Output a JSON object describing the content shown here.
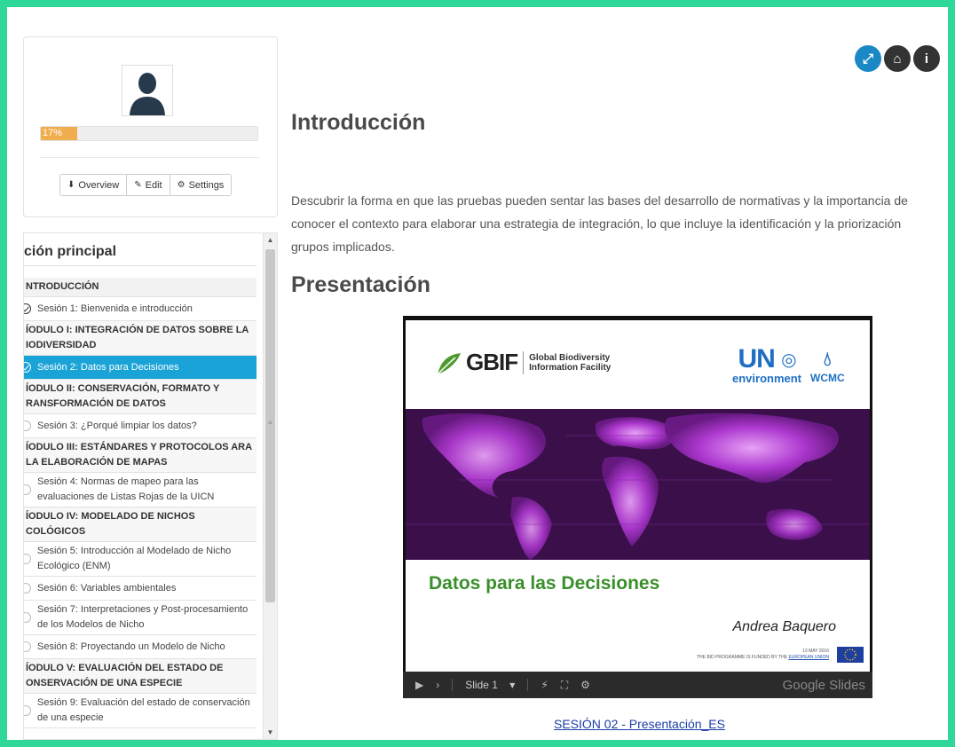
{
  "colors": {
    "frame": "#2fd899",
    "progress": "#f0ad4e",
    "active_item": "#1aa3d6",
    "icon_expand": "#1a88c4",
    "icon_home": "#333333",
    "icon_info": "#333333",
    "slide_title": "#3a8f2b",
    "un_blue": "#1e6fc4",
    "link": "#1a3ea8"
  },
  "profile": {
    "avatar_icon": "user-silhouette-icon",
    "progress_label": "17%",
    "progress_value": 0.17,
    "buttons": [
      {
        "icon": "download-icon",
        "label": "Overview"
      },
      {
        "icon": "pencil-icon",
        "label": "Edit"
      },
      {
        "icon": "gear-icon",
        "label": "Settings"
      }
    ]
  },
  "nav": {
    "title": "ción principal",
    "items": [
      {
        "type": "module",
        "text": "NTRODUCCIÓN"
      },
      {
        "type": "session",
        "text": "Sesión 1: Bienvenida e introducción",
        "done": true,
        "active": false
      },
      {
        "type": "module",
        "text": "ÍODULO I: INTEGRACIÓN DE DATOS SOBRE LA IODIVERSIDAD"
      },
      {
        "type": "session",
        "text": "Sesión 2: Datos para Decisiones",
        "done": true,
        "active": true
      },
      {
        "type": "module",
        "text": "ÍODULO II: CONSERVACIÓN, FORMATO Y RANSFORMACIÓN DE DATOS"
      },
      {
        "type": "session",
        "text": "Sesión 3: ¿Porqué limpiar los datos?",
        "done": false,
        "active": false
      },
      {
        "type": "module",
        "text": "ÍODULO III: ESTÁNDARES Y PROTOCOLOS ARA LA ELABORACIÓN DE MAPAS"
      },
      {
        "type": "session",
        "text": "Sesión 4: Normas de mapeo para las evaluaciones de Listas Rojas de la UICN",
        "done": false,
        "active": false
      },
      {
        "type": "module",
        "text": "ÍODULO IV: MODELADO DE NICHOS COLÓGICOS"
      },
      {
        "type": "session",
        "text": "Sesión 5: Introducción al Modelado de Nicho Ecológico (ENM)",
        "done": false,
        "active": false
      },
      {
        "type": "session",
        "text": "Sesión 6: Variables ambientales",
        "done": false,
        "active": false
      },
      {
        "type": "session",
        "text": "Sesión 7: Interpretaciones y Post-procesamiento de los Modelos de Nicho",
        "done": false,
        "active": false
      },
      {
        "type": "session",
        "text": "Sesión 8: Proyectando un Modelo de Nicho",
        "done": false,
        "active": false
      },
      {
        "type": "module",
        "text": "ÍODULO V: EVALUACIÓN DEL ESTADO DE ONSERVACIÓN DE UNA ESPECIE"
      },
      {
        "type": "session",
        "text": "Sesión 9: Evaluación del estado de conservación de una especie",
        "done": false,
        "active": false
      }
    ]
  },
  "top_icons": [
    {
      "name": "expand-icon",
      "glyph": "⤢"
    },
    {
      "name": "home-icon",
      "glyph": "⌂"
    },
    {
      "name": "info-icon",
      "glyph": "i"
    }
  ],
  "main": {
    "heading_intro": "Introducción",
    "intro_text": "Descubrir la forma en que las pruebas pueden sentar las bases del desarrollo de normativas y la importancia de conocer el contexto para elaborar una estrategia de integración, lo que incluye la identificación y la priorización grupos implicados.",
    "heading_presentation": "Presentación",
    "presentation_link": "SESIÓN 02 - Presentación_ES"
  },
  "slide": {
    "gbif_word": "GBIF",
    "gbif_sub_1": "Global Biodiversity",
    "gbif_sub_2": "Information Facility",
    "un_main": "UN",
    "un_sub": "environment",
    "wcmc": "WCMC",
    "title": "Datos para las Decisiones",
    "author": "Andrea Baquero",
    "footer_date": "13 MAY 2016",
    "footer_text": "THE BID PROGRAMME IS FUNDED BY THE",
    "footer_link": "EUROPEAN UNION",
    "controls": {
      "play_icon": "play-icon",
      "next_icon": "next-icon",
      "slide_label": "Slide 1",
      "dropdown_icon": "caret-down-icon",
      "pen_icon": "pen-icon",
      "fullscreen_icon": "fullscreen-icon",
      "settings_icon": "gear-icon",
      "brand": "Google Slides"
    }
  }
}
